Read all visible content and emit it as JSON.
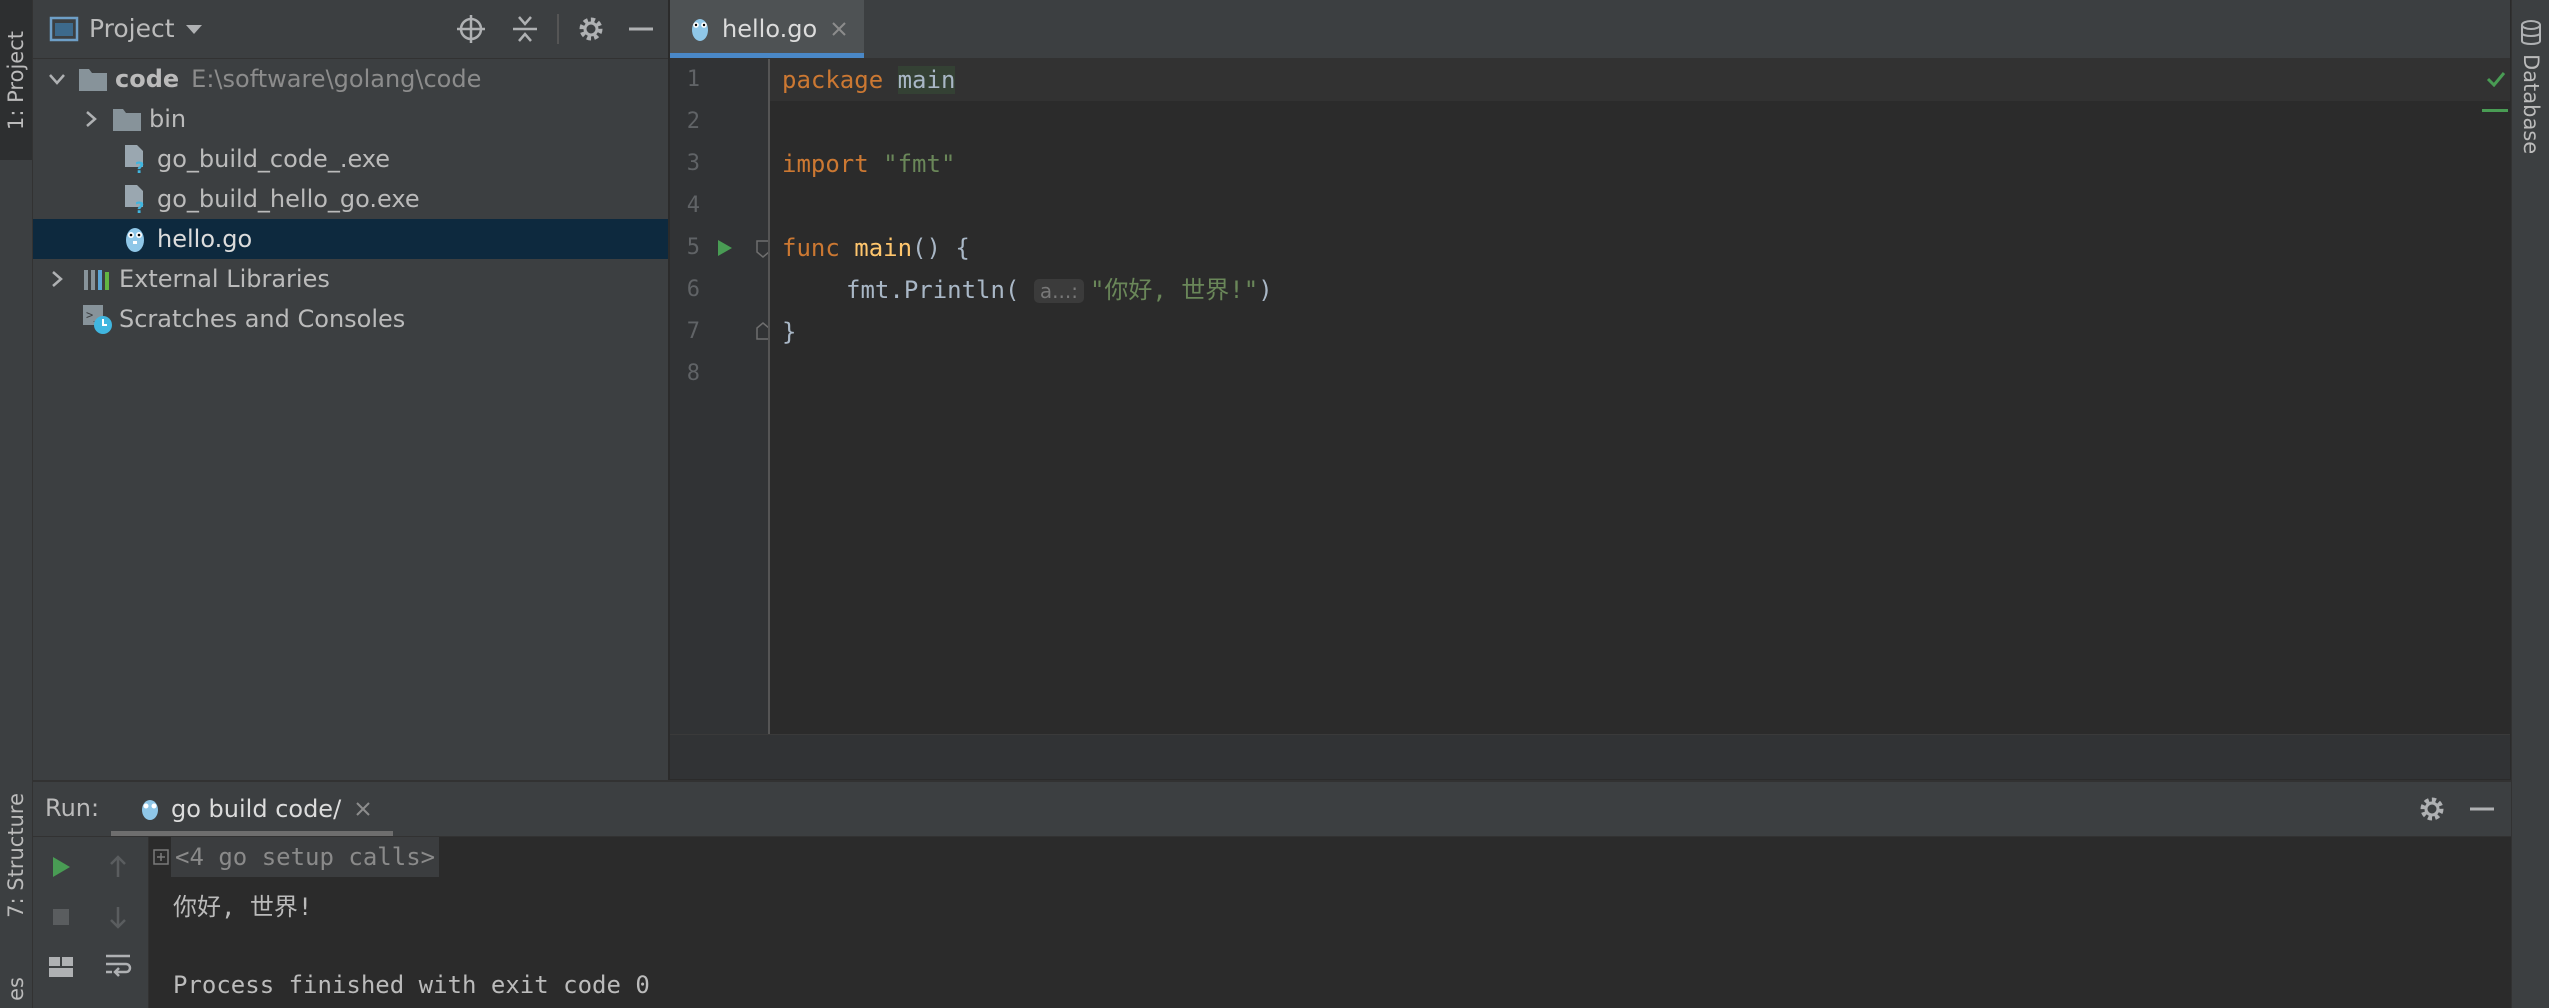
{
  "left_strip": {
    "project_tab": "1: Project",
    "structure_tab": "7: Structure",
    "favorites_tab": "es"
  },
  "right_strip": {
    "database_tab": "Database"
  },
  "project_panel": {
    "title": "Project",
    "tree": [
      {
        "label": "code",
        "path": "E:\\software\\golang\\code",
        "icon": "folder-icon",
        "expanded": true
      },
      {
        "label": "bin",
        "icon": "folder-icon",
        "expanded": false
      },
      {
        "label": "go_build_code_.exe",
        "icon": "unknown-file-icon"
      },
      {
        "label": "go_build_hello_go.exe",
        "icon": "unknown-file-icon"
      },
      {
        "label": "hello.go",
        "icon": "go-file-icon",
        "selected": true
      },
      {
        "label": "External Libraries",
        "icon": "libraries-icon",
        "expanded": false
      },
      {
        "label": "Scratches and Consoles",
        "icon": "scratches-icon"
      }
    ]
  },
  "editor": {
    "tab_label": "hello.go",
    "line_numbers": [
      "1",
      "2",
      "3",
      "4",
      "5",
      "6",
      "7",
      "8"
    ],
    "code": {
      "l1_kw": "package",
      "l1_name": "main",
      "l3_kw": "import",
      "l3_str": "\"fmt\"",
      "l5_kw": "func",
      "l5_name": "main",
      "l5_rest": "() {",
      "l6_pkg": "fmt",
      "l6_dot": ".",
      "l6_call": "Println(",
      "l6_hint": "a...:",
      "l6_str": "\"你好, 世界!\"",
      "l6_close": ")",
      "l7": "}"
    }
  },
  "run_panel": {
    "label": "Run:",
    "tab_label": "go build code/",
    "output": {
      "setup_calls": "<4 go setup calls>",
      "line1": "你好, 世界!",
      "line2": "",
      "line3": "Process finished with exit code 0"
    }
  },
  "colors": {
    "keyword": "#cc7832",
    "function": "#ffc66d",
    "string": "#6a8759",
    "accent": "#4a88c7",
    "selection": "#0d293e",
    "run_green": "#499c54"
  }
}
